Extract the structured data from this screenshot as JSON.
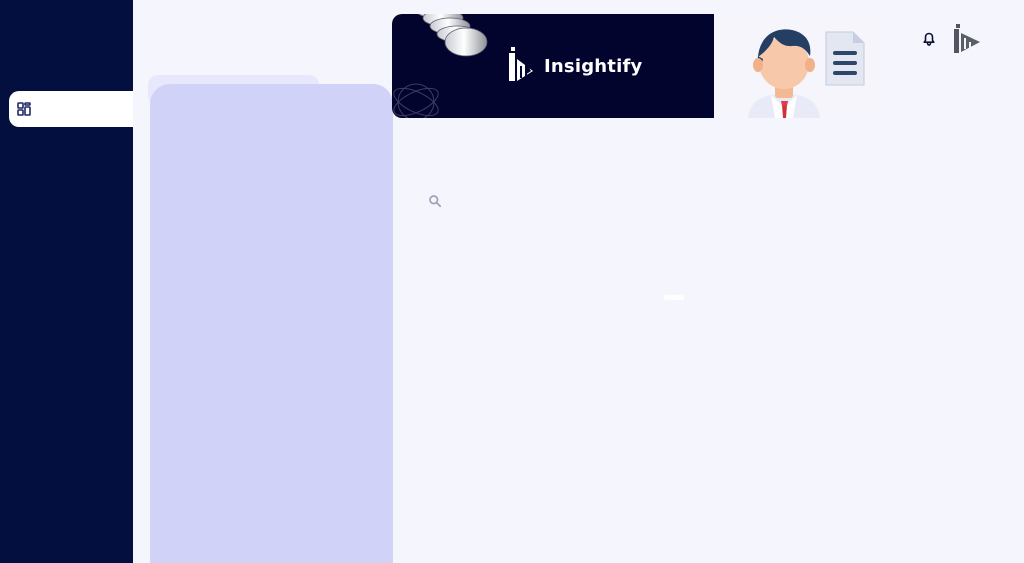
{
  "app": {
    "brand_name": "Insightify",
    "brand_mark": "im-logo"
  },
  "sidebar": {
    "active_item": {
      "icon": "dashboard-icon",
      "label": ""
    }
  },
  "subpanel": {
    "header": ""
  },
  "header": {
    "notification_icon": "bell-icon",
    "profile_icon": "im-logo"
  },
  "search": {
    "icon": "search-icon",
    "placeholder": "",
    "value": ""
  },
  "colors": {
    "sidebar": "#020f3f",
    "page_background": "#f5f5fd",
    "subpanel": "#d1d2f7",
    "subpanel_header": "#e7e8fb",
    "hero_dark": "#03042e",
    "brand_text": "#ffffff",
    "icon_dark": "#1e2766"
  }
}
